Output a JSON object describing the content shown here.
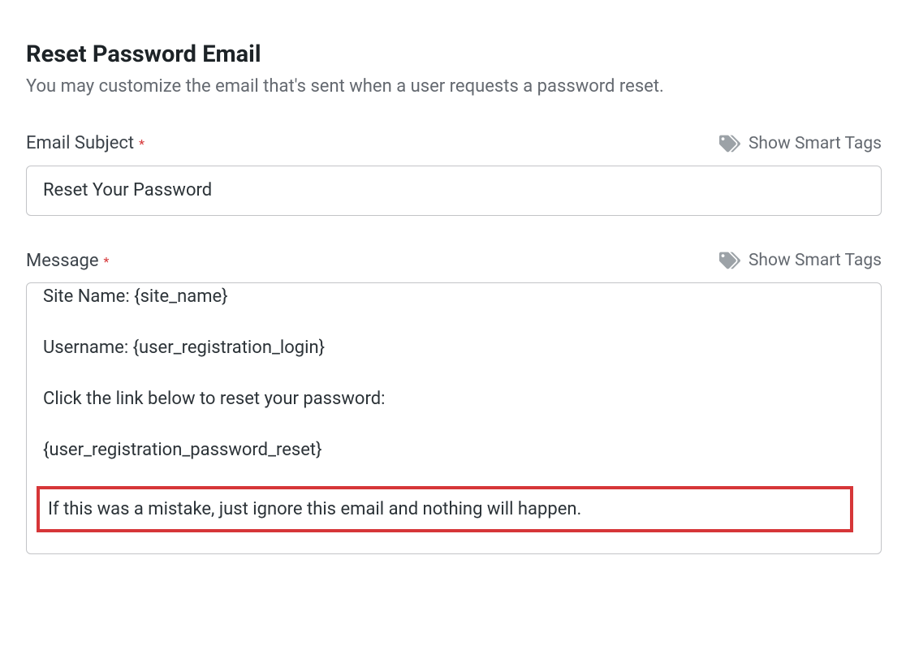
{
  "header": {
    "title": "Reset Password Email",
    "description": "You may customize the email that's sent when a user requests a password reset."
  },
  "smart_tags_label": "Show Smart Tags",
  "fields": {
    "subject": {
      "label": "Email Subject",
      "required_mark": "*",
      "value": "Reset Your Password"
    },
    "message": {
      "label": "Message",
      "required_mark": "*",
      "lines": {
        "l1": "Site Name: {site_name}",
        "l2": "Username: {user_registration_login}",
        "l3": "Click the link below to reset your password:",
        "l4": "{user_registration_password_reset}",
        "l5": "If this was a mistake, just ignore this email and nothing will happen."
      }
    }
  }
}
